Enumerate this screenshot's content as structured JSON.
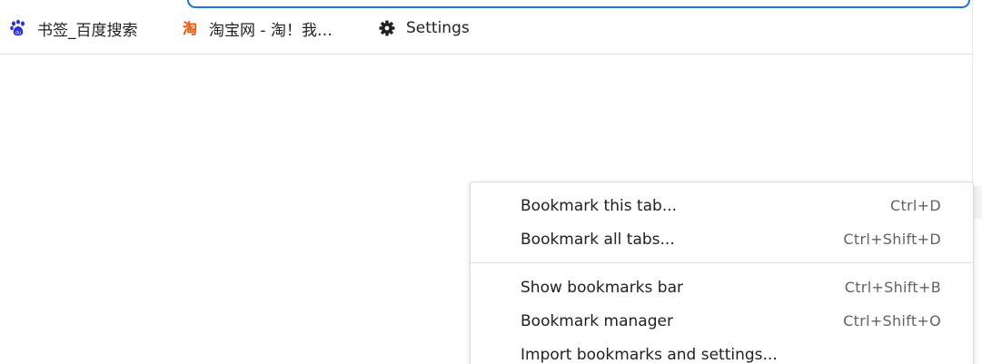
{
  "bookmarks_bar": {
    "items": [
      {
        "label": "书签_百度搜索",
        "icon": "baidu-paw-icon"
      },
      {
        "label": "淘宝网 - 淘！我…",
        "icon": "taobao-icon"
      },
      {
        "label": "Settings",
        "icon": "gear-icon"
      }
    ]
  },
  "menu": {
    "items": [
      {
        "label": "Bookmark this tab...",
        "shortcut": "Ctrl+D"
      },
      {
        "label": "Bookmark all tabs...",
        "shortcut": "Ctrl+Shift+D"
      },
      {
        "label": "Show bookmarks bar",
        "shortcut": "Ctrl+Shift+B"
      },
      {
        "label": "Bookmark manager",
        "shortcut": "Ctrl+Shift+O"
      },
      {
        "label": "Import bookmarks and settings...",
        "shortcut": ""
      }
    ]
  },
  "colors": {
    "accent": "#1a73e8",
    "baidu": "#2932e1",
    "taobao": "#ff5000",
    "text": "#202124",
    "shortcut": "#5f6368"
  }
}
